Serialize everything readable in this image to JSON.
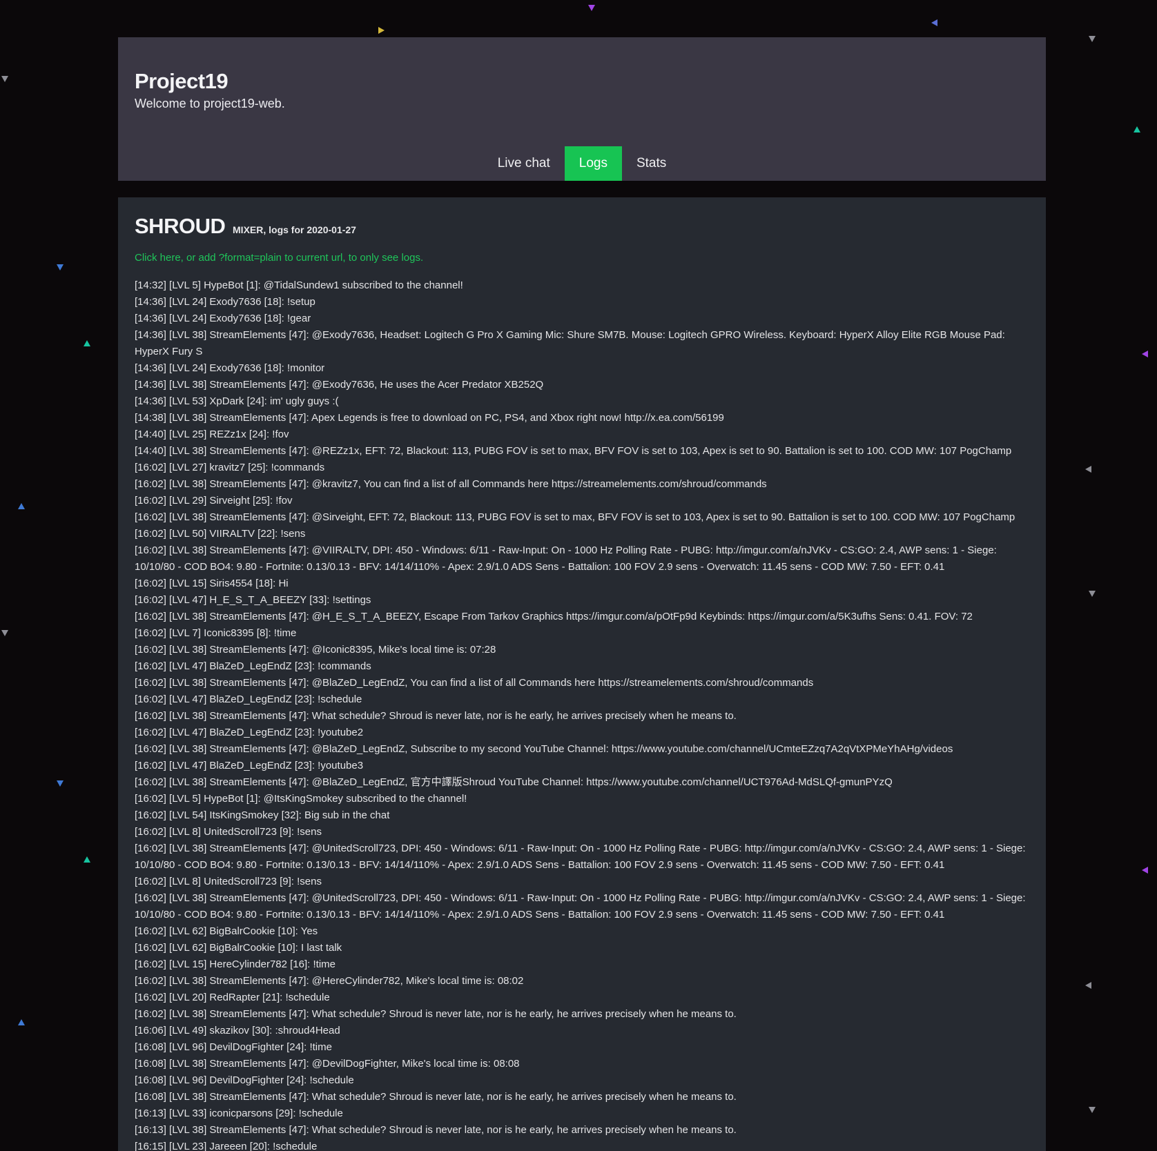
{
  "header": {
    "title": "Project19",
    "subtitle": "Welcome to project19-web."
  },
  "nav": {
    "tabs": [
      {
        "label": "Live chat",
        "active": false
      },
      {
        "label": "Logs",
        "active": true
      },
      {
        "label": "Stats",
        "active": false
      }
    ]
  },
  "colors": {
    "accent": "#17c453",
    "link": "#1fc55a",
    "header_bg": "#3a3744",
    "panel_bg": "#262a31",
    "page_bg": "#0b080a"
  },
  "logs": {
    "channel": "SHROUD",
    "meta": "MIXER, logs for 2020-01-27",
    "plain_link": "Click here, or add ?format=plain to current url, to only see logs.",
    "lines": [
      "[14:32] [LVL 5] HypeBot [1]: @TidalSundew1 subscribed to the channel!",
      "[14:36] [LVL 24] Exody7636 [18]: !setup",
      "[14:36] [LVL 24] Exody7636 [18]: !gear",
      "[14:36] [LVL 38] StreamElements [47]: @Exody7636, Headset: Logitech G Pro X Gaming Mic: Shure SM7B. Mouse: Logitech GPRO Wireless. Keyboard: HyperX Alloy Elite RGB Mouse Pad: HyperX Fury S",
      "[14:36] [LVL 24] Exody7636 [18]: !monitor",
      "[14:36] [LVL 38] StreamElements [47]: @Exody7636, He uses the Acer Predator XB252Q",
      "[14:36] [LVL 53] XpDark [24]: im' ugly guys :(",
      "[14:38] [LVL 38] StreamElements [47]: Apex Legends is free to download on PC, PS4, and Xbox right now! http://x.ea.com/56199",
      "[14:40] [LVL 25] REZz1x [24]: !fov",
      "[14:40] [LVL 38] StreamElements [47]: @REZz1x, EFT: 72, Blackout: 113, PUBG FOV is set to max, BFV FOV is set to 103, Apex is set to 90. Battalion is set to 100. COD MW: 107 PogChamp",
      "[16:02] [LVL 27] kravitz7 [25]: !commands",
      "[16:02] [LVL 38] StreamElements [47]: @kravitz7, You can find a list of all Commands here https://streamelements.com/shroud/commands",
      "[16:02] [LVL 29] Sirveight [25]: !fov",
      "[16:02] [LVL 38] StreamElements [47]: @Sirveight, EFT: 72, Blackout: 113, PUBG FOV is set to max, BFV FOV is set to 103, Apex is set to 90. Battalion is set to 100. COD MW: 107 PogChamp",
      "[16:02] [LVL 50] VIIRALTV [22]: !sens",
      "[16:02] [LVL 38] StreamElements [47]: @VIIRALTV, DPI: 450 - Windows: 6/11 - Raw-Input: On - 1000 Hz Polling Rate - PUBG: http://imgur.com/a/nJVKv - CS:GO: 2.4, AWP sens: 1 - Siege: 10/10/80 - COD BO4: 9.80 - Fortnite: 0.13/0.13 - BFV: 14/14/110% - Apex: 2.9/1.0 ADS Sens - Battalion: 100 FOV 2.9 sens - Overwatch: 11.45 sens - COD MW: 7.50 - EFT: 0.41",
      "[16:02] [LVL 15] Siris4554 [18]: Hi",
      "[16:02] [LVL 47] H_E_S_T_A_BEEZY [33]: !settings",
      "[16:02] [LVL 38] StreamElements [47]: @H_E_S_T_A_BEEZY, Escape From Tarkov Graphics https://imgur.com/a/pOtFp9d Keybinds: https://imgur.com/a/5K3ufhs Sens: 0.41. FOV: 72",
      "[16:02] [LVL 7] Iconic8395 [8]: !time",
      "[16:02] [LVL 38] StreamElements [47]: @Iconic8395, Mike's local time is: 07:28",
      "[16:02] [LVL 47] BlaZeD_LegEndZ [23]: !commands",
      "[16:02] [LVL 38] StreamElements [47]: @BlaZeD_LegEndZ, You can find a list of all Commands here https://streamelements.com/shroud/commands",
      "[16:02] [LVL 47] BlaZeD_LegEndZ [23]: !schedule",
      "[16:02] [LVL 38] StreamElements [47]: What schedule? Shroud is never late, nor is he early, he arrives precisely when he means to.",
      "[16:02] [LVL 47] BlaZeD_LegEndZ [23]: !youtube2",
      "[16:02] [LVL 38] StreamElements [47]: @BlaZeD_LegEndZ, Subscribe to my second YouTube Channel: https://www.youtube.com/channel/UCmteEZzq7A2qVtXPMeYhAHg/videos",
      "[16:02] [LVL 47] BlaZeD_LegEndZ [23]: !youtube3",
      "[16:02] [LVL 38] StreamElements [47]: @BlaZeD_LegEndZ, 官方中譯版Shroud YouTube Channel: https://www.youtube.com/channel/UCT976Ad-MdSLQf-gmunPYzQ",
      "[16:02] [LVL 5] HypeBot [1]: @ItsKingSmokey subscribed to the channel!",
      "[16:02] [LVL 54] ItsKingSmokey [32]: Big sub in the chat",
      "[16:02] [LVL 8] UnitedScroll723 [9]: !sens",
      "[16:02] [LVL 38] StreamElements [47]: @UnitedScroll723, DPI: 450 - Windows: 6/11 - Raw-Input: On - 1000 Hz Polling Rate - PUBG: http://imgur.com/a/nJVKv - CS:GO: 2.4, AWP sens: 1 - Siege: 10/10/80 - COD BO4: 9.80 - Fortnite: 0.13/0.13 - BFV: 14/14/110% - Apex: 2.9/1.0 ADS Sens - Battalion: 100 FOV 2.9 sens - Overwatch: 11.45 sens - COD MW: 7.50 - EFT: 0.41",
      "[16:02] [LVL 8] UnitedScroll723 [9]: !sens",
      "[16:02] [LVL 38] StreamElements [47]: @UnitedScroll723, DPI: 450 - Windows: 6/11 - Raw-Input: On - 1000 Hz Polling Rate - PUBG: http://imgur.com/a/nJVKv - CS:GO: 2.4, AWP sens: 1 - Siege: 10/10/80 - COD BO4: 9.80 - Fortnite: 0.13/0.13 - BFV: 14/14/110% - Apex: 2.9/1.0 ADS Sens - Battalion: 100 FOV 2.9 sens - Overwatch: 11.45 sens - COD MW: 7.50 - EFT: 0.41",
      "[16:02] [LVL 62] BigBalrCookie [10]: Yes",
      "[16:02] [LVL 62] BigBalrCookie [10]: I last talk",
      "[16:02] [LVL 15] HereCylinder782 [16]: !time",
      "[16:02] [LVL 38] StreamElements [47]: @HereCylinder782, Mike's local time is: 08:02",
      "[16:02] [LVL 20] RedRapter [21]: !schedule",
      "[16:02] [LVL 38] StreamElements [47]: What schedule? Shroud is never late, nor is he early, he arrives precisely when he means to.",
      "[16:06] [LVL 49] skazikov [30]:  :shroud4Head",
      "[16:08] [LVL 96] DevilDogFighter [24]: !time",
      "[16:08] [LVL 38] StreamElements [47]: @DevilDogFighter, Mike's local time is: 08:08",
      "[16:08] [LVL 96] DevilDogFighter [24]: !schedule",
      "[16:08] [LVL 38] StreamElements [47]: What schedule? Shroud is never late, nor is he early, he arrives precisely when he means to.",
      "[16:13] [LVL 33] iconicparsons [29]: !schedule",
      "[16:13] [LVL 38] StreamElements [47]: What schedule? Shroud is never late, nor is he early, he arrives precisely when he means to.",
      "[16:15] [LVL 23] Jareeen [20]: !schedule"
    ]
  }
}
